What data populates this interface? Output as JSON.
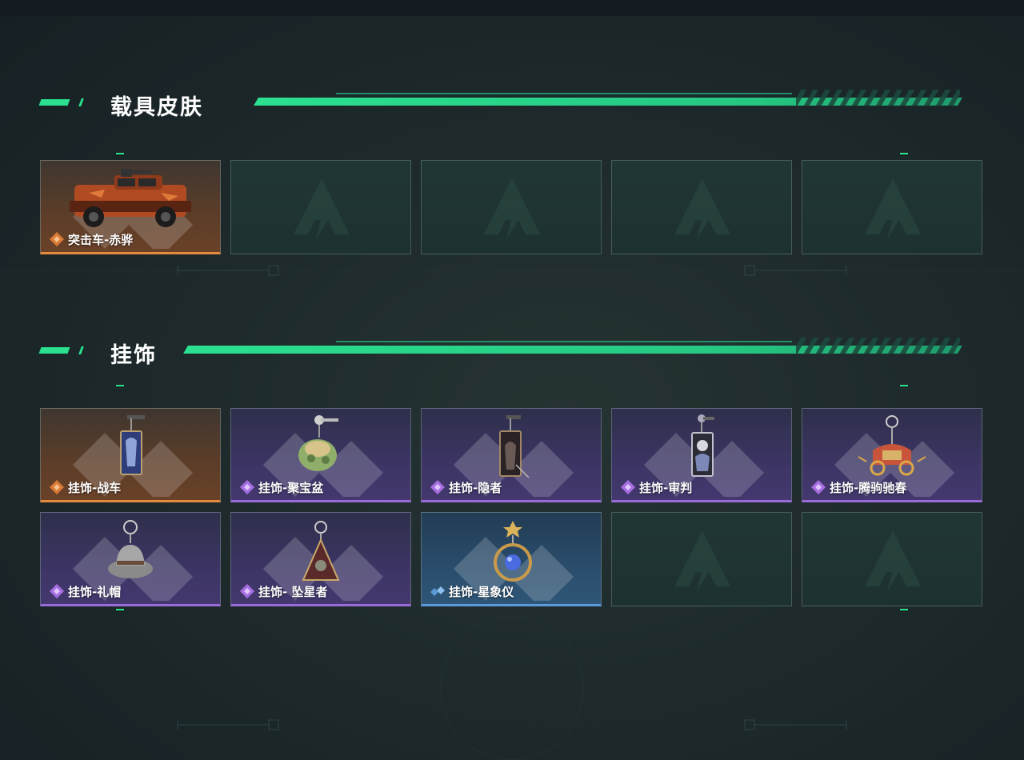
{
  "sections": [
    {
      "title": "载具皮肤",
      "items": [
        {
          "name": "突击车-赤骅",
          "rarity": "orange",
          "icon": "armored-vehicle-icon"
        },
        {
          "name": "",
          "rarity": "empty",
          "icon": "empty-slot-logo-icon"
        },
        {
          "name": "",
          "rarity": "empty",
          "icon": "empty-slot-logo-icon"
        },
        {
          "name": "",
          "rarity": "empty",
          "icon": "empty-slot-logo-icon"
        },
        {
          "name": "",
          "rarity": "empty",
          "icon": "empty-slot-logo-icon"
        }
      ]
    },
    {
      "title": "挂饰",
      "items": [
        {
          "name": "挂饰-战车",
          "rarity": "orange",
          "icon": "tarot-card-pendant-icon"
        },
        {
          "name": "挂饰-聚宝盆",
          "rarity": "purple",
          "icon": "treasure-bowl-pendant-icon"
        },
        {
          "name": "挂饰-隐者",
          "rarity": "purple",
          "icon": "tarot-card-pendant-icon"
        },
        {
          "name": "挂饰-审判",
          "rarity": "purple",
          "icon": "tarot-card-pendant-icon"
        },
        {
          "name": "挂饰-腾驹驰春",
          "rarity": "purple",
          "icon": "carriage-pendant-icon"
        },
        {
          "name": "挂饰-礼帽",
          "rarity": "purple",
          "icon": "hat-pendant-icon"
        },
        {
          "name": "挂饰- 坠星者",
          "rarity": "purple",
          "icon": "triangle-pendant-icon"
        },
        {
          "name": "挂饰-星象仪",
          "rarity": "blue",
          "icon": "astrolabe-pendant-icon"
        },
        {
          "name": "",
          "rarity": "empty",
          "icon": "empty-slot-logo-icon"
        },
        {
          "name": "",
          "rarity": "empty",
          "icon": "empty-slot-logo-icon"
        }
      ]
    }
  ],
  "colors": {
    "accent": "#2be08f",
    "orange": "#e38a3c",
    "purple": "#9a6ad8",
    "blue": "#5a9ad8"
  }
}
